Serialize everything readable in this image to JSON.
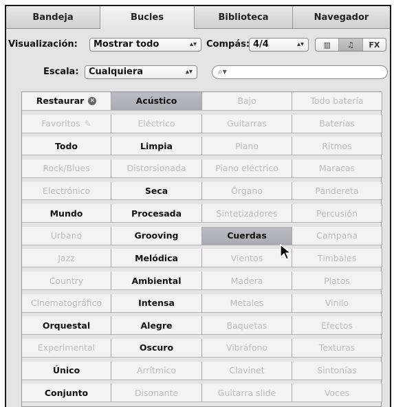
{
  "tabs": [
    "Bandeja",
    "Bucles",
    "Biblioteca",
    "Navegador"
  ],
  "active_tab": "Bucles",
  "controls": {
    "view_label": "Visualización:",
    "view_value": "Mostrar todo",
    "meter_label": "Compás:",
    "meter_value": "4/4",
    "scale_label": "Escala:",
    "scale_value": "Cualquiera",
    "search_placeholder": "",
    "view_modes": [
      "columns-icon",
      "music-note-icon",
      "fx-icon"
    ],
    "view_mode_labels": [
      "▥",
      "♫",
      "FX"
    ],
    "active_view_mode": "music-note-icon"
  },
  "keyword_grid": [
    [
      {
        "t": "Restaurar",
        "s": "on",
        "extra": "⊗"
      },
      {
        "t": "Acústico",
        "s": "sel"
      },
      {
        "t": "Bajo",
        "s": "off"
      },
      {
        "t": "Todo batería",
        "s": "off"
      }
    ],
    [
      {
        "t": "Favoritos",
        "s": "off",
        "extra": "✎"
      },
      {
        "t": "Eléctrico",
        "s": "off"
      },
      {
        "t": "Guitarras",
        "s": "off"
      },
      {
        "t": "Baterías",
        "s": "off"
      }
    ],
    [
      {
        "t": "Todo",
        "s": "on"
      },
      {
        "t": "Limpia",
        "s": "on"
      },
      {
        "t": "Piano",
        "s": "off"
      },
      {
        "t": "Ritmos",
        "s": "off"
      }
    ],
    [
      {
        "t": "Rock/Blues",
        "s": "off"
      },
      {
        "t": "Distorsionada",
        "s": "off"
      },
      {
        "t": "Piano eléctrico",
        "s": "off"
      },
      {
        "t": "Maracas",
        "s": "off"
      }
    ],
    [
      {
        "t": "Electrónico",
        "s": "off"
      },
      {
        "t": "Seca",
        "s": "on"
      },
      {
        "t": "Órgano",
        "s": "off"
      },
      {
        "t": "Pandereta",
        "s": "off"
      }
    ],
    [
      {
        "t": "Mundo",
        "s": "on"
      },
      {
        "t": "Procesada",
        "s": "on"
      },
      {
        "t": "Sintetizadores",
        "s": "off"
      },
      {
        "t": "Percusión",
        "s": "off"
      }
    ],
    [
      {
        "t": "Urbano",
        "s": "off"
      },
      {
        "t": "Grooving",
        "s": "on"
      },
      {
        "t": "Cuerdas",
        "s": "sel"
      },
      {
        "t": "Campana",
        "s": "off"
      }
    ],
    [
      {
        "t": "Jazz",
        "s": "off"
      },
      {
        "t": "Melódica",
        "s": "on"
      },
      {
        "t": "Vientos",
        "s": "off"
      },
      {
        "t": "Timbales",
        "s": "off"
      }
    ],
    [
      {
        "t": "Country",
        "s": "off"
      },
      {
        "t": "Ambiental",
        "s": "on"
      },
      {
        "t": "Madera",
        "s": "off"
      },
      {
        "t": "Platos",
        "s": "off"
      }
    ],
    [
      {
        "t": "Cinematográfico",
        "s": "off"
      },
      {
        "t": "Intensa",
        "s": "on"
      },
      {
        "t": "Metales",
        "s": "off"
      },
      {
        "t": "Vinilo",
        "s": "off"
      }
    ],
    [
      {
        "t": "Orquestal",
        "s": "on"
      },
      {
        "t": "Alegre",
        "s": "on"
      },
      {
        "t": "Baquetas",
        "s": "off"
      },
      {
        "t": "Efectos",
        "s": "off"
      }
    ],
    [
      {
        "t": "Experimental",
        "s": "off"
      },
      {
        "t": "Oscuro",
        "s": "on"
      },
      {
        "t": "Vibráfono",
        "s": "off"
      },
      {
        "t": "Texturas",
        "s": "off"
      }
    ],
    [
      {
        "t": "Único",
        "s": "on"
      },
      {
        "t": "Arrítmico",
        "s": "off"
      },
      {
        "t": "Clavinet",
        "s": "off"
      },
      {
        "t": "Sintonías",
        "s": "off"
      }
    ],
    [
      {
        "t": "Conjunto",
        "s": "on"
      },
      {
        "t": "Disonante",
        "s": "off"
      },
      {
        "t": "Guitarra slide",
        "s": "off"
      },
      {
        "t": "Voces",
        "s": "off"
      }
    ]
  ]
}
